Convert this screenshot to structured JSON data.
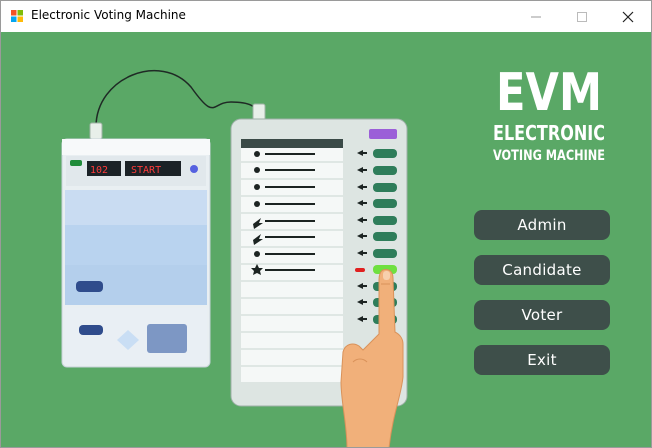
{
  "window": {
    "title": "Electronic Voting Machine",
    "controls": [
      "minimize",
      "maximize",
      "close"
    ]
  },
  "logo": {
    "line1": "EVM",
    "line2": "ELECTRONIC",
    "line3": "VOTING MACHINE"
  },
  "control_unit": {
    "display_number": "102",
    "display_status": "START"
  },
  "menu": {
    "admin": "Admin",
    "candidate": "Candidate",
    "voter": "Voter",
    "exit": "Exit"
  },
  "colors": {
    "background": "#5aa866",
    "button": "#3e4f4a",
    "button_text": "#ffffff",
    "display": "#ff3b3b"
  },
  "icons": {
    "app": "windows-flag-icon",
    "minimize": "minimize-icon",
    "maximize": "maximize-icon",
    "close": "close-icon"
  }
}
